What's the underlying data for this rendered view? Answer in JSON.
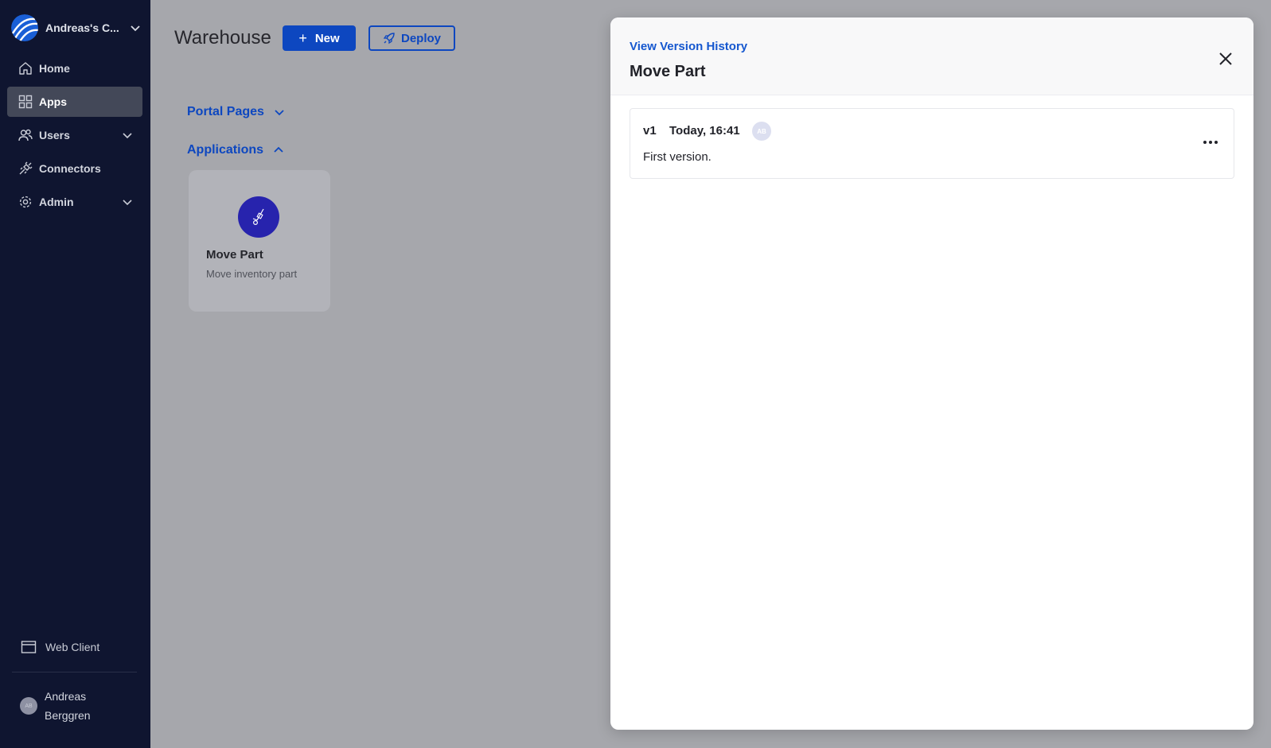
{
  "sidebar": {
    "org_name": "Andreas's C...",
    "nav": [
      {
        "label": "Home",
        "icon": "home-icon"
      },
      {
        "label": "Apps",
        "icon": "grid-icon",
        "active": true
      },
      {
        "label": "Users",
        "icon": "users-icon",
        "expandable": true
      },
      {
        "label": "Connectors",
        "icon": "plug-icon"
      },
      {
        "label": "Admin",
        "icon": "gear-icon",
        "expandable": true
      }
    ],
    "web_client": "Web Client",
    "user": {
      "initials": "AB",
      "name": "Andreas Berggren"
    }
  },
  "main": {
    "title": "Warehouse",
    "new_button": "New",
    "deploy_button": "Deploy",
    "sections": {
      "portal_pages": "Portal Pages",
      "applications": "Applications"
    },
    "app_card": {
      "name": "Move Part",
      "description": "Move inventory part",
      "icon": "hand-truck-icon"
    }
  },
  "modal": {
    "link": "View Version History",
    "title": "Move Part",
    "versions": [
      {
        "version": "v1",
        "time": "Today, 16:41",
        "author_initials": "AB",
        "description": "First version."
      }
    ]
  },
  "colors": {
    "sidebar_bg": "#0f1530",
    "accent": "#0d47c0",
    "app_icon_bg": "#2723ad",
    "overlay": "#a6a7ac"
  }
}
